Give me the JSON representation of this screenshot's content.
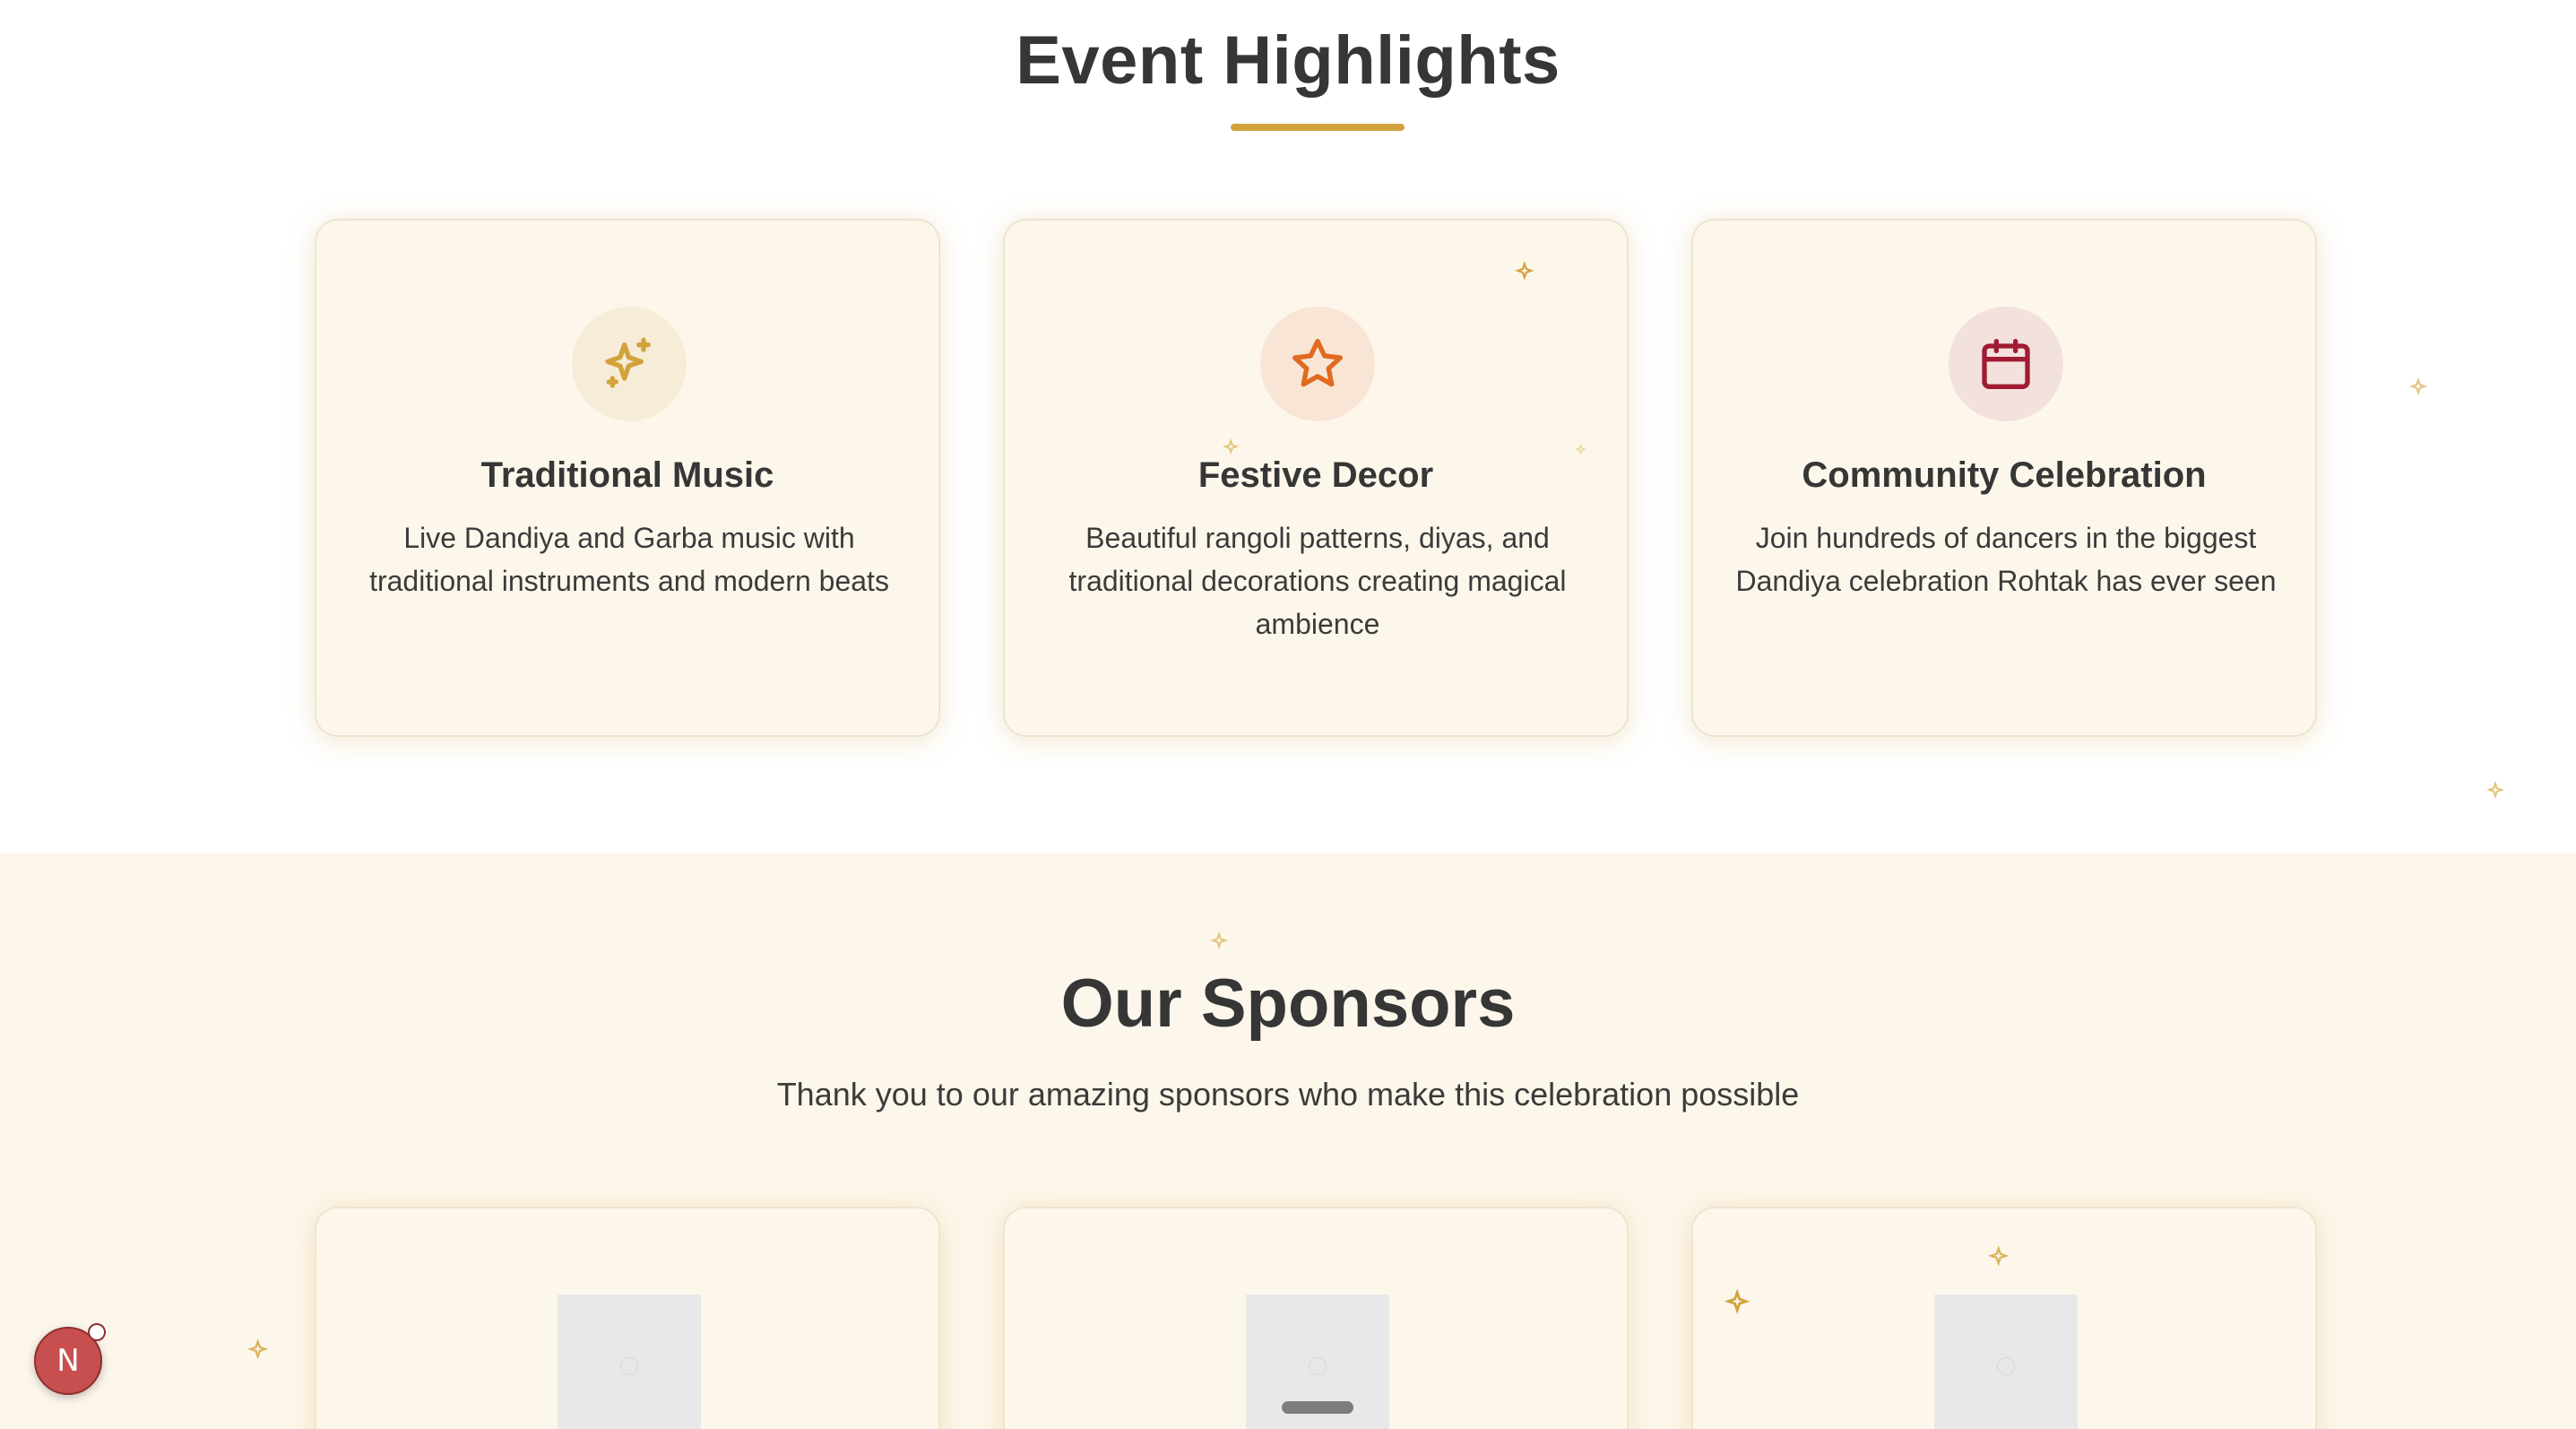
{
  "highlights": {
    "title": "Event Highlights",
    "accent_color": "#d2a23c",
    "cards": [
      {
        "icon": "sparkles-icon",
        "icon_color": "#d2a23c",
        "icon_bg": "#f6ecd7",
        "title": "Traditional Music",
        "description": "Live Dandiya and Garba music with traditional instruments and modern beats"
      },
      {
        "icon": "star-icon",
        "icon_color": "#e06a1e",
        "icon_bg": "#f8e5d5",
        "title": "Festive Decor",
        "description": "Beautiful rangoli patterns, diyas, and traditional decorations creating magical ambience"
      },
      {
        "icon": "calendar-icon",
        "icon_color": "#a01b32",
        "icon_bg": "#f3e1de",
        "title": "Community Celebration",
        "description": "Join hundreds of dancers in the biggest Dandiya celebration Rohtak has ever seen"
      }
    ]
  },
  "sponsors": {
    "title": "Our Sponsors",
    "subtitle": "Thank you to our amazing sponsors who make this celebration possible",
    "logos": [
      "image-placeholder-icon",
      "image-placeholder-icon",
      "image-placeholder-icon"
    ]
  },
  "badge": {
    "letter": "N",
    "color": "#c84f4f"
  }
}
